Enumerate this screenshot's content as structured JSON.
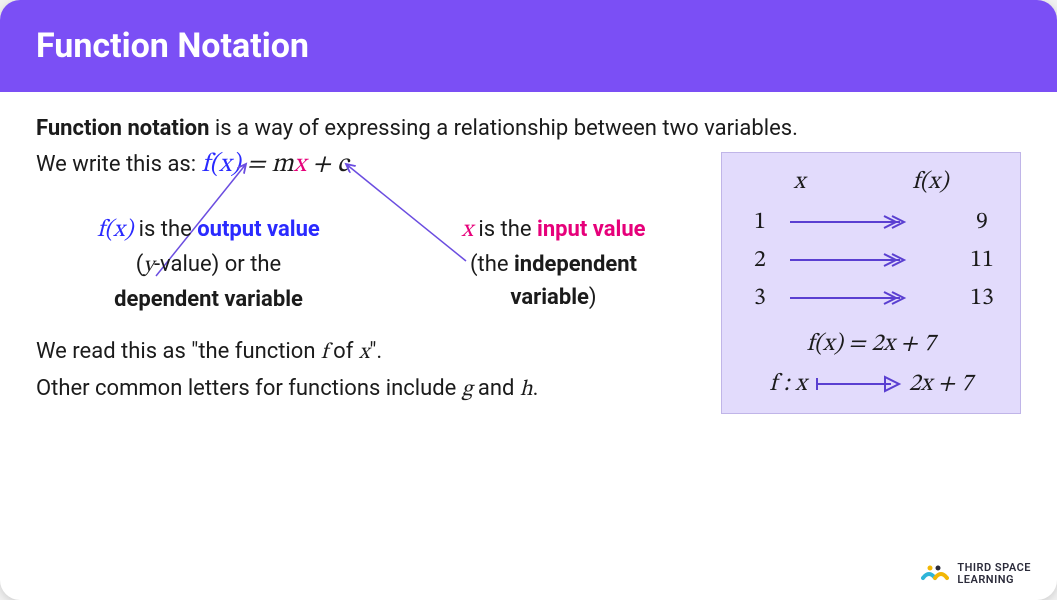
{
  "header": {
    "title": "Function Notation"
  },
  "intro": {
    "lead_bold": "Function notation",
    "lead_rest": " is a way of expressing a relationship between two variables.",
    "write_as": "We write this as: ",
    "formula_fx": "f(x)",
    "formula_mid": " = m",
    "formula_x": "x",
    "formula_end": " + c"
  },
  "ann_left": {
    "fx": "f(x)",
    "line1_rest": " is the ",
    "out_label": "output value",
    "line2_open": "(",
    "yval": "y",
    "line2_rest": "-value) or the",
    "line3": "dependent variable"
  },
  "ann_right": {
    "x": "x",
    "line1_rest": " is the ",
    "in_label": "input value",
    "line2": "(the ",
    "indep": "independent",
    "line3_pre": "variable",
    "line3_close": ")"
  },
  "read": {
    "line1_a": "We read this as \"the function ",
    "line1_f": "f",
    "line1_of": " of ",
    "line1_x": "x",
    "line1_end": "\".",
    "line2_a": "Other common letters for functions include ",
    "line2_g": "g",
    "line2_and": " and ",
    "line2_h": "h",
    "line2_end": "."
  },
  "fnbox": {
    "hdr_x": "x",
    "hdr_fx": "f(x)",
    "rows": [
      {
        "in": "1",
        "out": "9"
      },
      {
        "in": "2",
        "out": "11"
      },
      {
        "in": "3",
        "out": "13"
      }
    ],
    "eq": "f(x) = 2x + 7",
    "map_left": "f : x",
    "map_right": "2x + 7"
  },
  "logo": {
    "line1": "THIRD SPACE",
    "line2": "LEARNING"
  }
}
